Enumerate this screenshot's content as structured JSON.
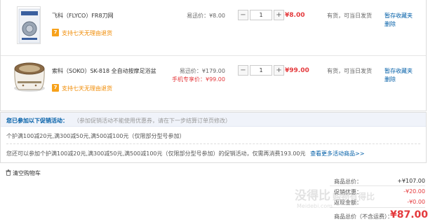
{
  "items": [
    {
      "name": "飞科（FLYCO）FR8刀网",
      "return_badge": "7",
      "return_text": "支持七天无理由退货",
      "price_label": "易迅价：¥8.00",
      "mobile_price_label": "",
      "qty": "1",
      "minus": "−",
      "plus": "+",
      "subtotal": "¥8.00",
      "stock": "有货，可当日发货",
      "actions": [
        "暂存收藏夹",
        "删除"
      ]
    },
    {
      "name": "索科（SOKO）SK-818 全自动按摩足浴盆",
      "return_badge": "7",
      "return_text": "支持七天无理由退货",
      "price_label": "易迅价：¥179.00",
      "mobile_price_label": "手机专享价：¥99.00",
      "qty": "1",
      "minus": "−",
      "plus": "+",
      "subtotal": "¥99.00",
      "stock": "有货，可当日发货",
      "actions": [
        "暂存收藏夹",
        "删除"
      ]
    }
  ],
  "promo": {
    "title": "您已参加以下促销活动：",
    "note": "（参加促销活动不能使用优惠券，请在下一步结算订单页修改）",
    "line1": "个护满100减20元,满300减50元,满500减100元（仅限部分型号参加）",
    "line2": "您还可以参加个护满100减20元,满300减50元,满500减100元（仅限部分型号参加）的促销活动，仅需再消费193.00元",
    "link": "查看更多活动商品>>"
  },
  "clear_cart": "清空购物车",
  "summary": {
    "goods_total_label": "商品总价：",
    "goods_total_value": "+¥107.00",
    "discount_label": "促销优惠：",
    "discount_value": "-¥20.00",
    "credit_label": "返现金额：",
    "credit_value": "-¥0.00",
    "total_label": "商品总价（不含运费）：",
    "total_value": "¥87.00"
  },
  "watermark": {
    "text": "没得比",
    "text_tail": "购物有得比",
    "url": "Meidebi.com"
  },
  "colors": {
    "price_red": "#e4393c",
    "link_blue": "#005ea7",
    "return_orange": "#f7a21b"
  }
}
